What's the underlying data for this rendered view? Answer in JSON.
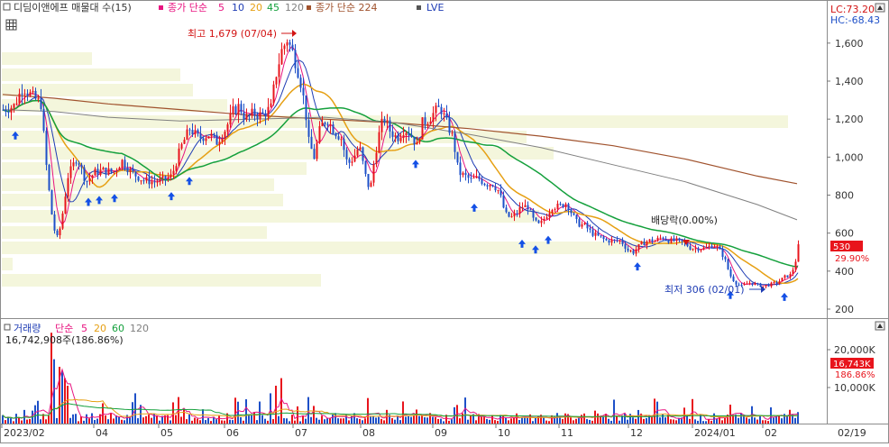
{
  "price_panel": {
    "legend": {
      "stock_label": "디딤이앤에프 매물대 수(15)",
      "ma_label": "종가 단순",
      "ma_periods": [
        "5",
        "10",
        "20",
        "45",
        "120"
      ],
      "ma224_label": "종가 단순 224",
      "lve_label": "LVE"
    },
    "indicator_lc": "LC:73.20",
    "indicator_hc": "HC:-68.43",
    "high_annotation": "최고 1,679 (07/04)",
    "low_annotation": "최저 306 (02/01)",
    "dividend_annotation": "배당락(0.00%)",
    "current_price": "530",
    "current_change": "29.90%",
    "y_ticks": [
      "1,600",
      "1,400",
      "1,200",
      "1,000",
      "800",
      "600",
      "400",
      "200"
    ]
  },
  "volume_panel": {
    "legend_label": "거래량",
    "ma_label": "단순",
    "ma_periods": [
      "5",
      "20",
      "60",
      "120"
    ],
    "volume_value": "16,742,908주(186.86%)",
    "current_volume": "16,743K",
    "current_volume_change": "186.86%",
    "y_ticks": [
      "20,000K",
      "10,000K"
    ]
  },
  "x_axis": {
    "labels": [
      "2023/02",
      "04",
      "05",
      "06",
      "07",
      "08",
      "09",
      "10",
      "11",
      "12",
      "2024/01",
      "02"
    ],
    "right_label": "02/19"
  },
  "colors": {
    "up_candle": "#e8141c",
    "down_candle": "#1e50c8",
    "ma5": "#e81480",
    "ma10": "#1e3cb4",
    "ma20": "#e6a014",
    "ma45": "#14a03c",
    "ma120": "#808080",
    "ma224": "#a0522d",
    "volume_profile": "#f4f6dc",
    "signal_arrow": "#1450e6"
  },
  "chart_data": {
    "type": "candlestick",
    "series": [
      {
        "name": "종가 단순 5"
      },
      {
        "name": "10"
      },
      {
        "name": "20"
      },
      {
        "name": "45"
      },
      {
        "name": "120"
      },
      {
        "name": "종가 단순 224"
      },
      {
        "name": "LVE"
      }
    ],
    "price_ylim": [
      150,
      1780
    ],
    "volume_ylim": [
      0,
      26000
    ],
    "volume_unit": "K",
    "high": {
      "value": 1679,
      "date": "07/04"
    },
    "low": {
      "value": 306,
      "date": "02/01"
    },
    "last_close": 530,
    "last_change_pct": 29.9,
    "last_volume": 16742908,
    "grid": false
  }
}
